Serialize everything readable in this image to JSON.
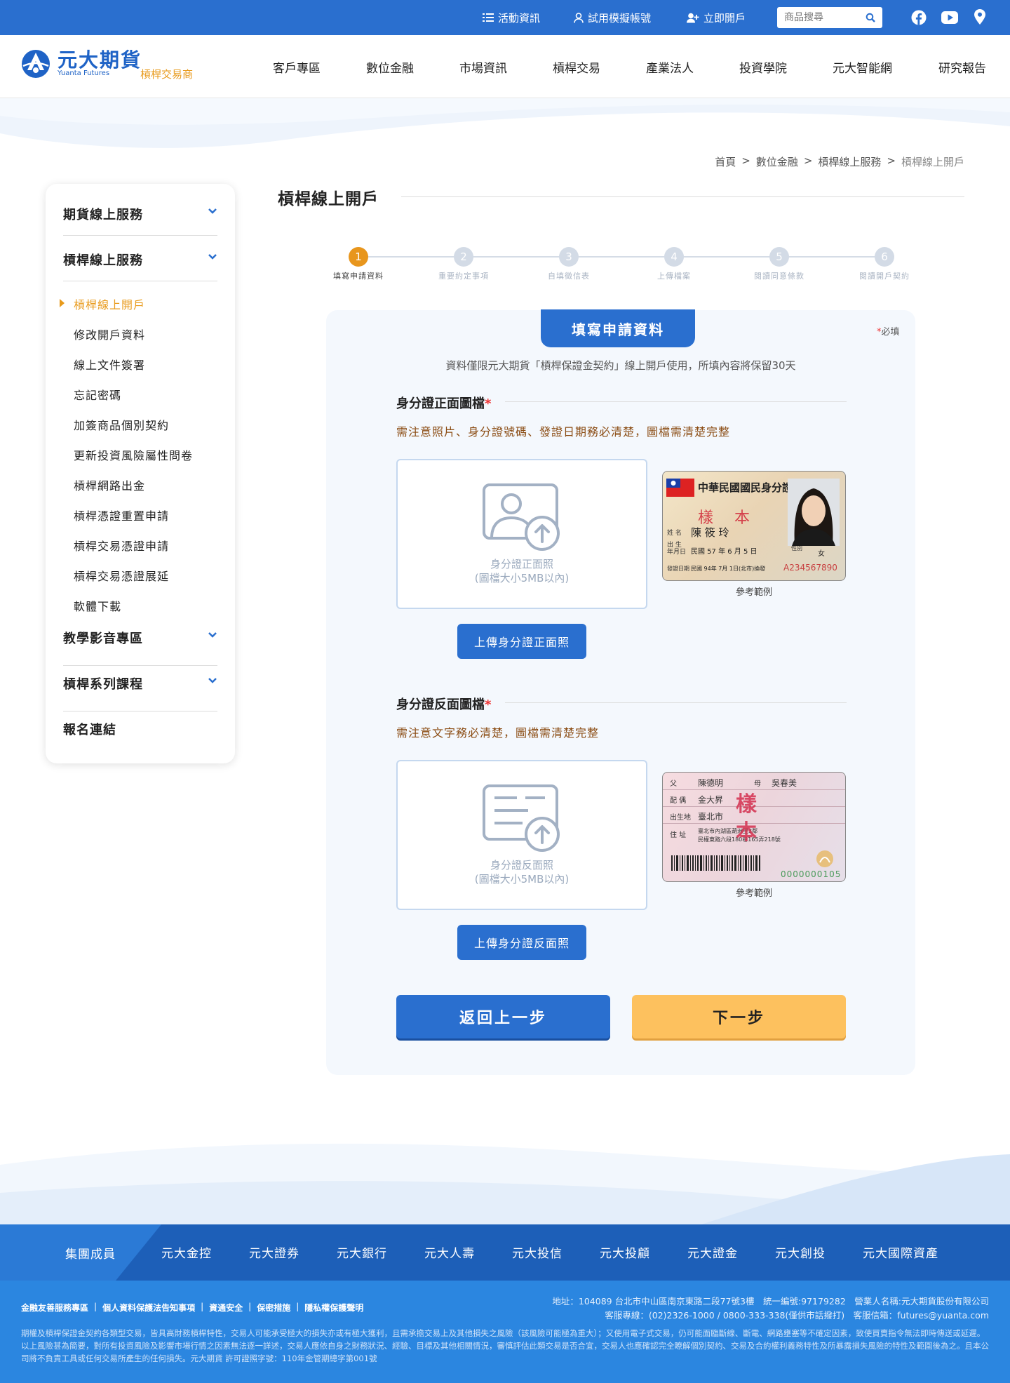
{
  "topbar": {
    "links": [
      "活動資訊",
      "試用模擬帳號",
      "立即開戶"
    ],
    "search_placeholder": "商品搜尋"
  },
  "header": {
    "logo_cn": "元大期貨",
    "logo_en": "Yuanta Futures",
    "logo_sub": "槓桿交易商",
    "nav": [
      "客戶專區",
      "數位金融",
      "市場資訊",
      "槓桿交易",
      "產業法人",
      "投資學院",
      "元大智能網",
      "研究報告"
    ]
  },
  "breadcrumb": [
    "首頁",
    "數位金融",
    "槓桿線上服務",
    "槓桿線上開戶"
  ],
  "breadcrumb_sep": ">",
  "sidebar": {
    "groups": [
      "期貨線上服務",
      "槓桿線上服務"
    ],
    "items": [
      "槓桿線上開戶",
      "修改開戶資料",
      "線上文件簽署",
      "忘記密碼",
      "加簽商品個別契約",
      "更新投資風險屬性問卷",
      "槓桿網路出金",
      "槓桿憑證重置申請",
      "槓桿交易憑證申請",
      "槓桿交易憑證展延",
      "軟體下載"
    ],
    "groups_after": [
      "教學影音專區",
      "槓桿系列課程",
      "報名連結"
    ]
  },
  "page_title": "槓桿線上開戶",
  "steps": [
    {
      "num": "1",
      "label": "填寫申請資料"
    },
    {
      "num": "2",
      "label": "重要約定事項"
    },
    {
      "num": "3",
      "label": "自填徵信表"
    },
    {
      "num": "4",
      "label": "上傳檔案"
    },
    {
      "num": "5",
      "label": "閱讀同意條款"
    },
    {
      "num": "6",
      "label": "閱讀開戶契約"
    }
  ],
  "panel": {
    "tab": "填寫申請資料",
    "required_star": "*",
    "required_label": "必填",
    "notice": "資料僅限元大期貨「槓桿保證金契約」線上開戶使用，所填內容將保留30天"
  },
  "front": {
    "title": "身分證正面圖檔",
    "star": "*",
    "note": "需注意照片、身分證號碼、發證日期務必清楚，圖檔需清楚完整",
    "caption1": "身分證正面照",
    "caption2": "(圖檔大小5MB以內)",
    "button": "上傳身分證正面照",
    "sample_caption": "參考範例",
    "sample": {
      "header": "中華民國國民身分證",
      "stamp": "樣　本",
      "name_label": "姓 名",
      "name": "陳 筱 玲",
      "birth_label": "出 生\n年月日",
      "birth": "民國 57 年 6 月 5 日",
      "sex_label": "性別",
      "sex": "女",
      "issue_label": "發證日期",
      "issue": "民國 94年 7月 1日(北市)換發",
      "id": "A234567890"
    }
  },
  "back": {
    "title": "身分證反面圖檔",
    "star": "*",
    "note": "需注意文字務必清楚，圖檔需清楚完整",
    "caption1": "身分證反面照",
    "caption2": "(圖檔大小5MB以內)",
    "button": "上傳身分證反面照",
    "sample_caption": "參考範例",
    "sample": {
      "father_label": "父",
      "father": "陳德明",
      "mother_label": "母",
      "mother": "吳春美",
      "spouse_label": "配 偶",
      "spouse": "金大昇",
      "birthplace_label": "出生地",
      "birthplace": "臺北市",
      "address_label": "住 址",
      "address1": "臺北市內湖區葫洲里3鄰",
      "address2": "民權東路六段180巷165弄218號",
      "stamp": "樣本",
      "serial": "0000000105"
    }
  },
  "buttons": {
    "back": "返回上一步",
    "next": "下一步"
  },
  "footer": {
    "group_label": "集團成員",
    "group_items": [
      "元大金控",
      "元大證券",
      "元大銀行",
      "元大人壽",
      "元大投信",
      "元大投顧",
      "元大證金",
      "元大創投",
      "元大國際資產"
    ],
    "links": [
      "金融友善服務專區",
      "個人資料保護法告知事項",
      "資通安全",
      "保密措施",
      "隱私權保護聲明"
    ],
    "link_sep": "|",
    "address": "地址：104089 台北市中山區南京東路二段77號3樓　統一編號:97179282　營業人名稱:元大期貨股份有限公司",
    "service": "客服專線：(02)2326-1000 / 0800-333-338(僅供市話撥打)　客服信箱：futures@yuanta.com",
    "disclaimer": "期權及槓桿保證金契約各類型交易，皆具高財務槓桿特性，交易人可能承受極大的損失亦或有極大獲利，且需承擔交易上及其他損失之風險（該風險可能極為重大）；又使用電子式交易，仍可能面臨斷線、斷電、網路壅塞等不確定因素，致使買賣指令無法即時傳送或延遲。以上風險甚為簡要，對所有投資風險及影響市場行情之因素無法逐一詳述，交易人應依自身之財務狀況、經驗、目標及其他相關情況，審慎評估此類交易是否合宜，交易人也應確認完全瞭解個別契約、交易及合約權利義務特性及所暴露損失風險的特性及範圍後為之。且本公司將不負責工具或任何交易所產生的任何損失。元大期貨 許可證照字號：110年金管期總字第001號"
  },
  "colors": {
    "primary": "#2a6fcf",
    "accent": "#e8961d",
    "next_button": "#fdc15e",
    "note_brown": "#8a4b12"
  }
}
